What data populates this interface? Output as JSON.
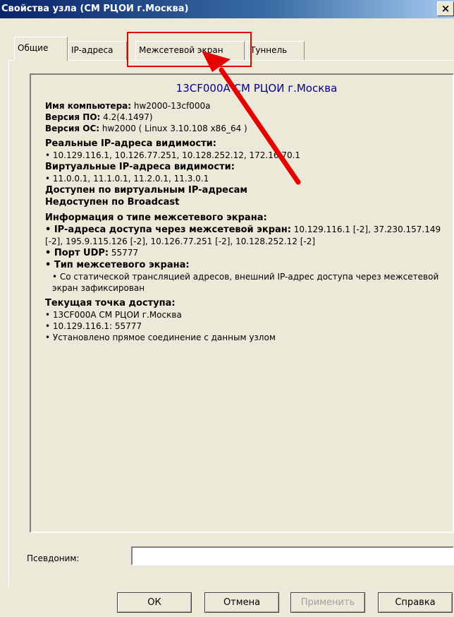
{
  "window": {
    "title": "Свойства узла (СМ РЦОИ г.Москва)",
    "close_glyph": "×"
  },
  "tabs": [
    {
      "label": "Общие",
      "active": true
    },
    {
      "label": "IP-адреса",
      "active": false
    },
    {
      "label": "Межсетевой экран",
      "active": false
    },
    {
      "label": "Туннель",
      "active": false
    }
  ],
  "info": {
    "node_title": "13CF000A СМ РЦОИ г.Москва",
    "computer_name_label": "Имя компьютера:",
    "computer_name_value": " hw2000-13cf000a",
    "software_version_label": "Версия ПО:",
    "software_version_value": " 4.2(4.1497)",
    "os_version_label": "Версия ОС:",
    "os_version_value": " hw2000 ( Linux 3.10.108 x86_64 )",
    "real_ips_heading": "Реальные IP-адреса видимости:",
    "real_ips": "• 10.129.116.1, 10.126.77.251, 10.128.252.12, 172.16.70.1",
    "virtual_ips_heading": "Виртуальные IP-адреса видимости:",
    "virtual_ips": "• 11.0.0.1, 11.1.0.1, 11.2.0.1, 11.3.0.1",
    "virtual_access": "Доступен по виртуальным IP-адресам",
    "broadcast": "Недоступен по Broadcast",
    "firewall_heading": "Информация о типе межсетевого экрана:",
    "fw_ips_label": "• IP-адреса доступа через межсетевой экран:",
    "fw_ips_value": " 10.129.116.1 [-2], 37.230.157.149 [-2], 195.9.115.126 [-2], 10.126.77.251 [-2], 10.128.252.12 [-2]",
    "udp_label": "• Порт UDP:",
    "udp_value": " 55777",
    "fw_type_label": "• Тип межсетевого экрана:",
    "fw_type_value": "• Со статической трансляцией адресов, внешний IP-адрес доступа через межсетевой экран зафиксирован",
    "access_point_heading": "Текущая точка доступа:",
    "access_point_lines": [
      "• 13CF000A СМ РЦОИ г.Москва",
      "• 10.129.116.1: 55777",
      "• Установлено прямое соединение с данным узлом"
    ]
  },
  "alias": {
    "label": "Псевдоним:",
    "value": ""
  },
  "buttons": {
    "ok": "ОК",
    "cancel": "Отмена",
    "apply": "Применить",
    "help": "Справка"
  },
  "colors": {
    "node_title": "#00008b",
    "annotation": "#e60000",
    "titlebar_start": "#0a246a"
  }
}
